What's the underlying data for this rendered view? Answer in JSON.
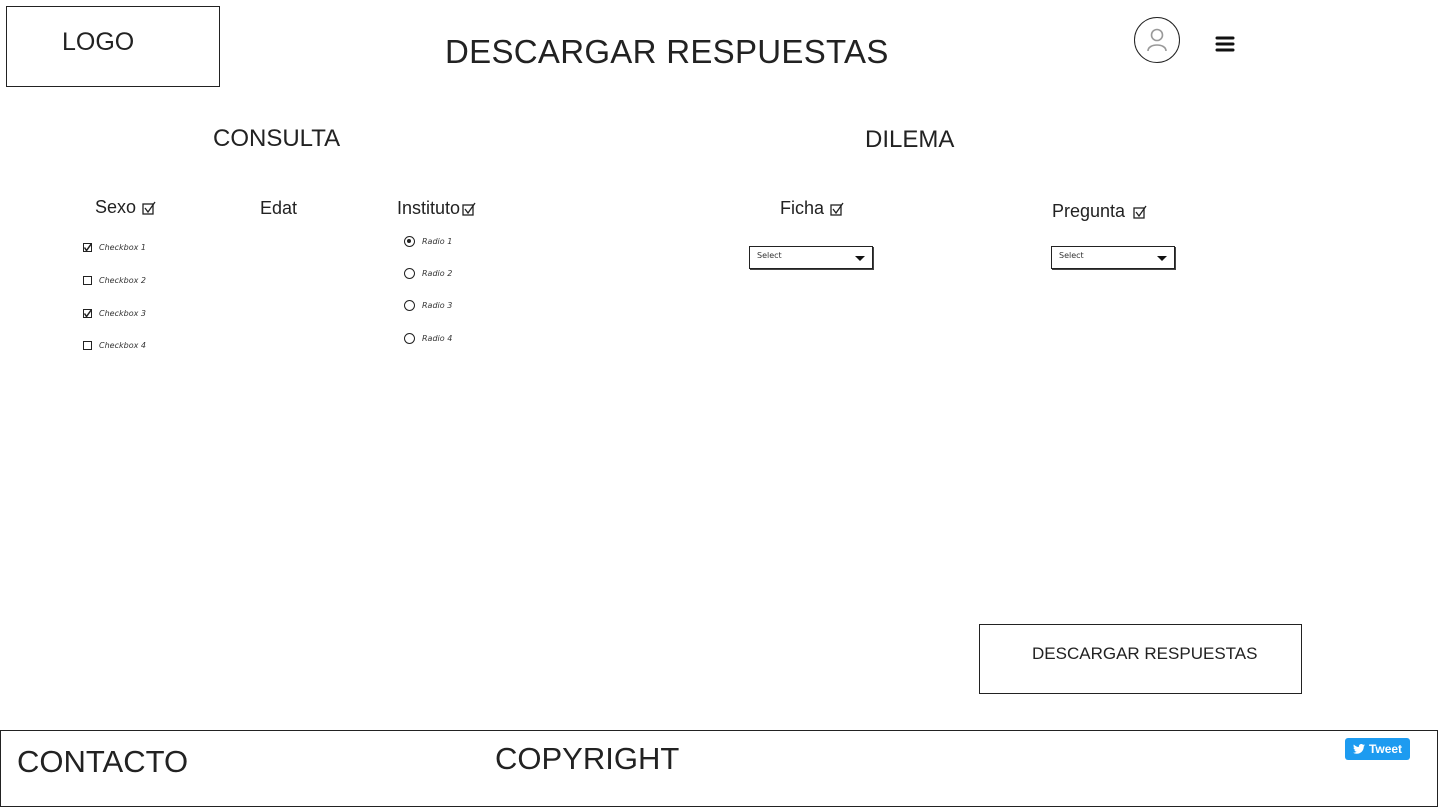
{
  "header": {
    "logo": "LOGO",
    "title": "DESCARGAR RESPUESTAS",
    "avatar_icon": "user-avatar-icon",
    "menu_icon": "hamburger-menu-icon"
  },
  "consulta": {
    "title": "CONSULTA",
    "sexo": {
      "label": "Sexo",
      "options": [
        {
          "label": "Checkbox 1",
          "checked": true
        },
        {
          "label": "Checkbox 2",
          "checked": false
        },
        {
          "label": "Checkbox 3",
          "checked": true
        },
        {
          "label": "Checkbox 4",
          "checked": false
        }
      ]
    },
    "edat": {
      "label": "Edat"
    },
    "instituto": {
      "label": "Instituto",
      "options": [
        {
          "label": "Radio 1",
          "selected": true
        },
        {
          "label": "Radio 2",
          "selected": false
        },
        {
          "label": "Radio 3",
          "selected": false
        },
        {
          "label": "Radio 4",
          "selected": false
        }
      ]
    }
  },
  "dilema": {
    "title": "DILEMA",
    "ficha": {
      "label": "Ficha",
      "select_value": "Select"
    },
    "pregunta": {
      "label": "Pregunta",
      "select_value": "Select"
    }
  },
  "actions": {
    "download_label": "DESCARGAR RESPUESTAS"
  },
  "footer": {
    "contact": "CONTACTO",
    "copyright": "COPYRIGHT",
    "tweet_label": "Tweet"
  }
}
